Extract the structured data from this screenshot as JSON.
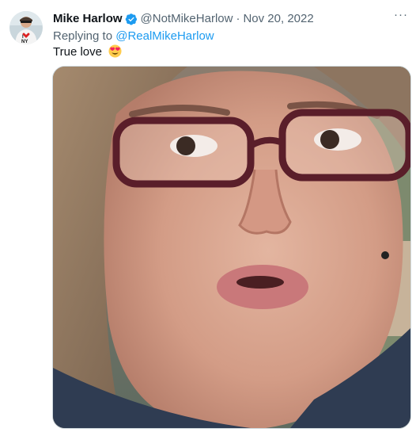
{
  "tweet": {
    "author_name": "Mike Harlow",
    "verified": true,
    "handle": "@NotMikeHarlow",
    "separator": "·",
    "date": "Nov 20, 2022",
    "replying_prefix": "Replying to",
    "replying_to": "@RealMikeHarlow",
    "text": "True love",
    "emoji": "smiling-face-with-heart-eyes",
    "more_menu": "···"
  },
  "avatar": {
    "shirt_text": "I ♥ NY"
  },
  "colors": {
    "link": "#1d9bf0",
    "muted": "#536471",
    "text": "#0f1419",
    "verified": "#1d9bf0"
  }
}
